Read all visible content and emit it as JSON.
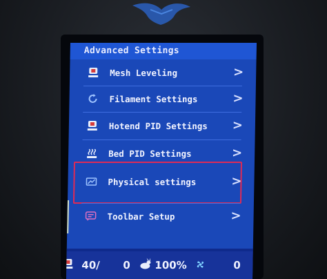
{
  "screen": {
    "title": "Advanced Settings",
    "menu": [
      {
        "label": "Mesh Leveling",
        "icon": "mesh-leveling-icon",
        "chevron": ">"
      },
      {
        "label": "Filament Settings",
        "icon": "filament-icon",
        "chevron": ">"
      },
      {
        "label": "Hotend PID Settings",
        "icon": "hotend-icon",
        "chevron": ">"
      },
      {
        "label": "Bed PID Settings",
        "icon": "bed-heat-icon",
        "chevron": ">"
      },
      {
        "label": "Physical settings",
        "icon": "physical-settings-icon",
        "chevron": ">"
      },
      {
        "label": "Toolbar Setup",
        "icon": "toolbar-icon",
        "chevron": ">"
      }
    ],
    "highlighted_item": "Physical settings"
  },
  "status_bar": {
    "hotend_temp": "40/",
    "hotend_target": "0",
    "speed": "100%",
    "fan": "0"
  },
  "colors": {
    "screen_bg": "#1a48b8",
    "title_bar": "#1f56d4",
    "status_bar": "#17339a",
    "highlight_border": "#e02a55"
  }
}
